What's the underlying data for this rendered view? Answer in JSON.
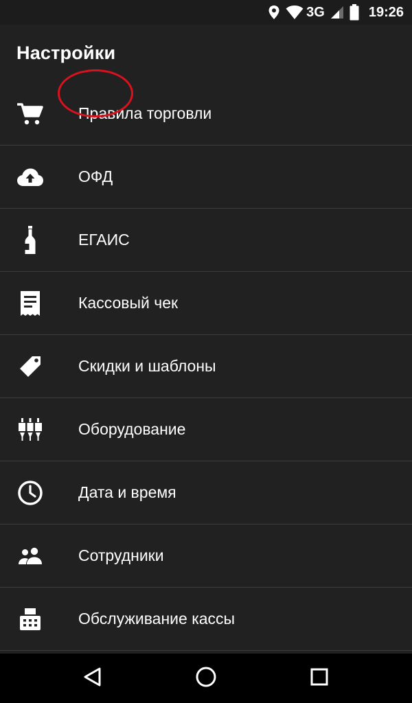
{
  "status_bar": {
    "network": "3G",
    "time": "19:26"
  },
  "header": {
    "title": "Настройки"
  },
  "settings": {
    "items": [
      {
        "label": "Правила торговли",
        "icon": "shopping-cart-icon"
      },
      {
        "label": "ОФД",
        "icon": "cloud-upload-icon"
      },
      {
        "label": "ЕГАИС",
        "icon": "bottle-icon"
      },
      {
        "label": "Кассовый чек",
        "icon": "receipt-icon"
      },
      {
        "label": "Скидки и шаблоны",
        "icon": "tag-icon"
      },
      {
        "label": "Оборудование",
        "icon": "equipment-icon"
      },
      {
        "label": "Дата и время",
        "icon": "clock-icon"
      },
      {
        "label": "Сотрудники",
        "icon": "people-icon"
      },
      {
        "label": "Обслуживание кассы",
        "icon": "cash-register-icon"
      }
    ]
  },
  "colors": {
    "background": "#212121",
    "divider": "#3d3d3d",
    "text": "#ffffff",
    "highlight": "#d9121f"
  }
}
